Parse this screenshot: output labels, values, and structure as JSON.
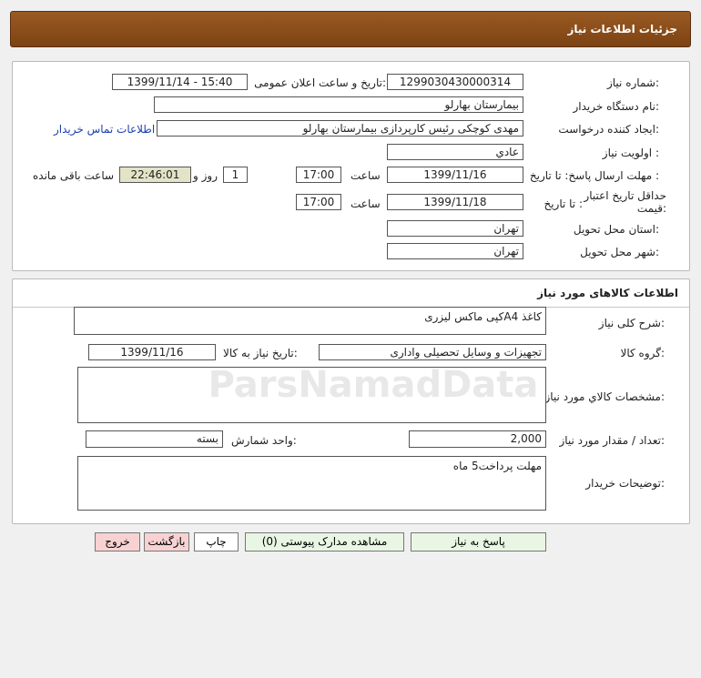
{
  "header": {
    "title": "جزئیات اطلاعات نیاز"
  },
  "need_info": {
    "need_number_label": "شماره نیاز:",
    "need_number": "1299030430000314",
    "announce_label": "تاریخ و ساعت اعلان عمومی:",
    "announce_value": "1399/11/14 - 15:40",
    "buyer_org_label": "نام دستگاه خریدار:",
    "buyer_org": "بیمارستان بهارلو",
    "requester_label": "ایجاد کننده درخواست:",
    "requester": "مهدی کوچکی  رئیس کارپردازی بیمارستان بهارلو",
    "contact_link": "اطلاعات تماس خریدار",
    "priority_label": "اولویت نیاز :",
    "priority": "عادي",
    "deadline_label": "مهلت ارسال پاسخ: تا تاریخ :",
    "deadline_date": "1399/11/16",
    "time_label": "ساعت",
    "deadline_time": "17:00",
    "days_count": "1",
    "days_label": "روز و",
    "remaining_time": "22:46:01",
    "remaining_label": "ساعت باقی مانده",
    "validity_label": "حداقل تاریخ اعتبار قیمت:",
    "validity_to_label": "تا تاریخ :",
    "validity_date": "1399/11/18",
    "validity_time_label": "ساعت",
    "validity_time": "17:00",
    "province_label": "استان محل تحویل:",
    "province": "تهران",
    "city_label": "شهر محل تحویل:",
    "city": "تهران"
  },
  "goods": {
    "section_title": "اطلاعات کالاهای مورد نیاز",
    "desc_label": "شرح کلی نیاز:",
    "desc": "کاغذ A4کپی ماکس لیزری",
    "group_label": "گروه کالا:",
    "group": "تجهیزات و وسایل تحصیلی واداری",
    "need_date_label": "تاریخ نیاز به کالا:",
    "need_date": "1399/11/16",
    "specs_label": "مشخصات کالاي مورد نیاز:",
    "specs": "",
    "qty_label": "تعداد / مقدار مورد نیاز:",
    "qty": "2,000",
    "unit_label": "واحد شمارش:",
    "unit": "بسته",
    "buyer_notes_label": "توضیحات خریدار:",
    "buyer_notes": "مهلت پرداخت5 ماه"
  },
  "buttons": {
    "reply": "پاسخ به نیاز",
    "attachments": "مشاهده مدارک پیوستی (0)",
    "print": "چاپ",
    "back": "بازگشت",
    "exit": "خروج"
  },
  "watermark": {
    "text": "ParsNamadData"
  }
}
